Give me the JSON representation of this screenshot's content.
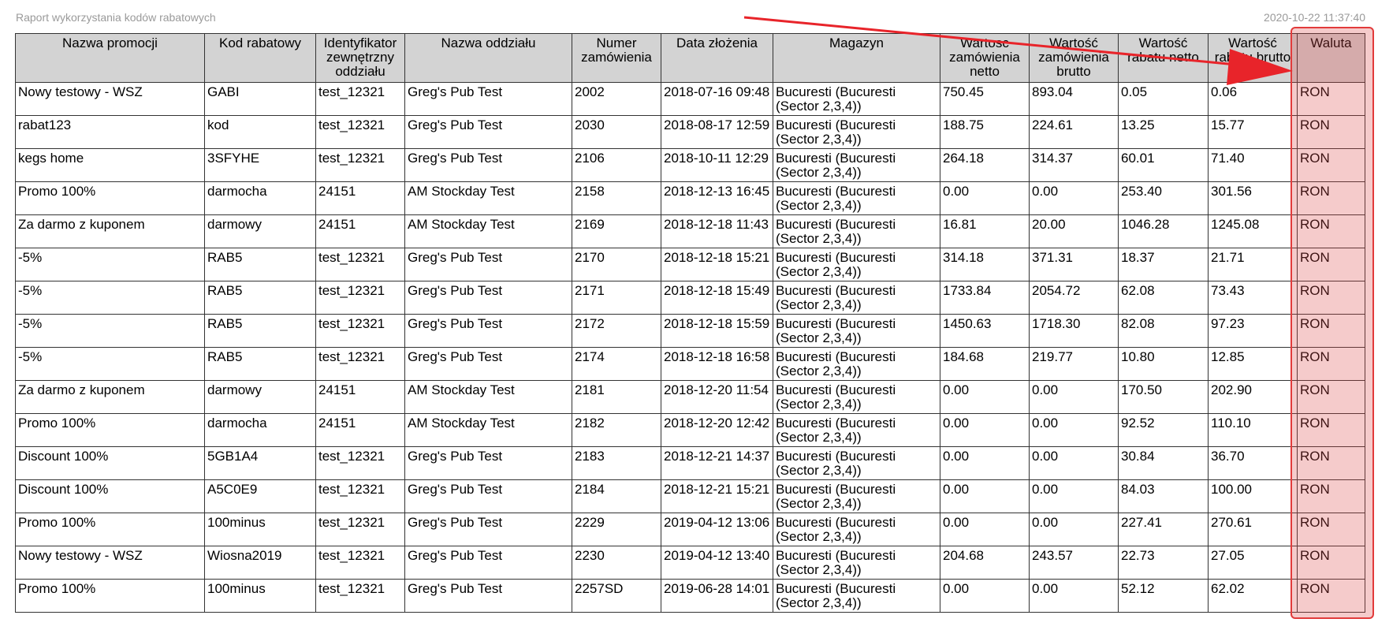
{
  "report": {
    "title": "Raport wykorzystania kodów rabatowych",
    "timestamp": "2020-10-22 11:37:40"
  },
  "table": {
    "headers": [
      "Nazwa promocji",
      "Kod rabatowy",
      "Identyfikator zewnętrzny oddziału",
      "Nazwa oddziału",
      "Numer zamówienia",
      "Data złożenia",
      "Magazyn",
      "Wartosc zamówienia netto",
      "Wartość zamówienia brutto",
      "Wartość rabatu netto",
      "Wartość rabatu brutto",
      "Waluta"
    ],
    "rows": [
      [
        "Nowy testowy - WSZ",
        "GABI",
        "test_12321",
        "Greg's Pub Test",
        "2002",
        "2018-07-16 09:48",
        "Bucuresti (Bucuresti (Sector 2,3,4))",
        "750.45",
        "893.04",
        "0.05",
        "0.06",
        "RON"
      ],
      [
        "rabat123",
        "kod",
        "test_12321",
        "Greg's Pub Test",
        "2030",
        "2018-08-17 12:59",
        "Bucuresti (Bucuresti (Sector 2,3,4))",
        "188.75",
        "224.61",
        "13.25",
        "15.77",
        "RON"
      ],
      [
        "kegs home",
        "3SFYHE",
        "test_12321",
        "Greg's Pub Test",
        "2106",
        "2018-10-11 12:29",
        "Bucuresti (Bucuresti (Sector 2,3,4))",
        "264.18",
        "314.37",
        "60.01",
        "71.40",
        "RON"
      ],
      [
        "Promo 100%",
        "darmocha",
        "24151",
        "AM Stockday Test",
        "2158",
        "2018-12-13 16:45",
        "Bucuresti (Bucuresti (Sector 2,3,4))",
        "0.00",
        "0.00",
        "253.40",
        "301.56",
        "RON"
      ],
      [
        "Za darmo z kuponem",
        "darmowy",
        "24151",
        "AM Stockday Test",
        "2169",
        "2018-12-18 11:43",
        "Bucuresti (Bucuresti (Sector 2,3,4))",
        "16.81",
        "20.00",
        "1046.28",
        "1245.08",
        "RON"
      ],
      [
        "-5%",
        "RAB5",
        "test_12321",
        "Greg's Pub Test",
        "2170",
        "2018-12-18 15:21",
        "Bucuresti (Bucuresti (Sector 2,3,4))",
        "314.18",
        "371.31",
        "18.37",
        "21.71",
        "RON"
      ],
      [
        "-5%",
        "RAB5",
        "test_12321",
        "Greg's Pub Test",
        "2171",
        "2018-12-18 15:49",
        "Bucuresti (Bucuresti (Sector 2,3,4))",
        "1733.84",
        "2054.72",
        "62.08",
        "73.43",
        "RON"
      ],
      [
        "-5%",
        "RAB5",
        "test_12321",
        "Greg's Pub Test",
        "2172",
        "2018-12-18 15:59",
        "Bucuresti (Bucuresti (Sector 2,3,4))",
        "1450.63",
        "1718.30",
        "82.08",
        "97.23",
        "RON"
      ],
      [
        "-5%",
        "RAB5",
        "test_12321",
        "Greg's Pub Test",
        "2174",
        "2018-12-18 16:58",
        "Bucuresti (Bucuresti (Sector 2,3,4))",
        "184.68",
        "219.77",
        "10.80",
        "12.85",
        "RON"
      ],
      [
        "Za darmo z kuponem",
        "darmowy",
        "24151",
        "AM Stockday Test",
        "2181",
        "2018-12-20 11:54",
        "Bucuresti (Bucuresti (Sector 2,3,4))",
        "0.00",
        "0.00",
        "170.50",
        "202.90",
        "RON"
      ],
      [
        "Promo 100%",
        "darmocha",
        "24151",
        "AM Stockday Test",
        "2182",
        "2018-12-20 12:42",
        "Bucuresti (Bucuresti (Sector 2,3,4))",
        "0.00",
        "0.00",
        "92.52",
        "110.10",
        "RON"
      ],
      [
        "Discount 100%",
        "5GB1A4",
        "test_12321",
        "Greg's Pub Test",
        "2183",
        "2018-12-21 14:37",
        "Bucuresti (Bucuresti (Sector 2,3,4))",
        "0.00",
        "0.00",
        "30.84",
        "36.70",
        "RON"
      ],
      [
        "Discount 100%",
        "A5C0E9",
        "test_12321",
        "Greg's Pub Test",
        "2184",
        "2018-12-21 15:21",
        "Bucuresti (Bucuresti (Sector 2,3,4))",
        "0.00",
        "0.00",
        "84.03",
        "100.00",
        "RON"
      ],
      [
        "Promo 100%",
        "100minus",
        "test_12321",
        "Greg's Pub Test",
        "2229",
        "2019-04-12 13:06",
        "Bucuresti (Bucuresti (Sector 2,3,4))",
        "0.00",
        "0.00",
        "227.41",
        "270.61",
        "RON"
      ],
      [
        "Nowy testowy - WSZ",
        "Wiosna2019",
        "test_12321",
        "Greg's Pub Test",
        "2230",
        "2019-04-12 13:40",
        "Bucuresti (Bucuresti (Sector 2,3,4))",
        "204.68",
        "243.57",
        "22.73",
        "27.05",
        "RON"
      ],
      [
        "Promo 100%",
        "100minus",
        "test_12321",
        "Greg's Pub Test",
        "2257SD",
        "2019-06-28 14:01",
        "Bucuresti (Bucuresti (Sector 2,3,4))",
        "0.00",
        "0.00",
        "52.12",
        "62.02",
        "RON"
      ]
    ]
  },
  "annotation": {
    "arrow_color": "#e8242a",
    "highlight_color": "#e23b3b",
    "highlight_target": "Waluta"
  }
}
